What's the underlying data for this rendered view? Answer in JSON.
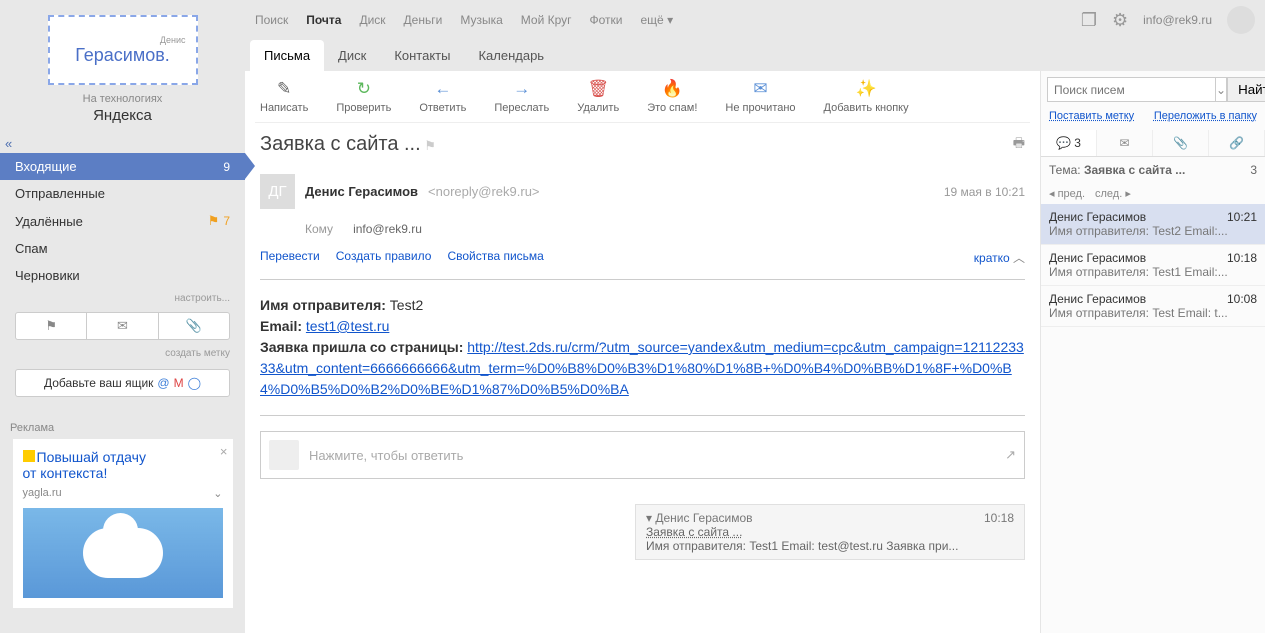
{
  "logo": {
    "name": "Герасимов.",
    "sub": "Денис"
  },
  "tech_label": "На технологиях",
  "yandex": "Яндекса",
  "folders": {
    "items": [
      {
        "label": "Входящие",
        "count": "9"
      },
      {
        "label": "Отправленные",
        "count": ""
      },
      {
        "label": "Удалённые",
        "count": "7"
      },
      {
        "label": "Спам",
        "count": ""
      },
      {
        "label": "Черновики",
        "count": ""
      }
    ],
    "setup": "настроить...",
    "create_label": "создать метку"
  },
  "add_box": "Добавьте ваш ящик",
  "ad": {
    "header": "Реклама",
    "title1": "Повышай отдачу",
    "title2": "от контекста!",
    "domain": "yagla.ru"
  },
  "topnav": {
    "items": [
      "Поиск",
      "Почта",
      "Диск",
      "Деньги",
      "Музыка",
      "Мой Круг",
      "Фотки",
      "ещё"
    ],
    "email": "info@rek9.ru"
  },
  "tabs": [
    "Письма",
    "Диск",
    "Контакты",
    "Календарь"
  ],
  "toolbar": [
    {
      "label": "Написать",
      "icon": "✎",
      "color": "#888"
    },
    {
      "label": "Проверить",
      "icon": "↻",
      "color": "#5cb85c"
    },
    {
      "label": "Ответить",
      "icon": "←",
      "color": "#5a8fd6"
    },
    {
      "label": "Переслать",
      "icon": "→",
      "color": "#5a8fd6"
    },
    {
      "label": "Удалить",
      "icon": "🗑",
      "color": "#d9534f"
    },
    {
      "label": "Это спам!",
      "icon": "🔥",
      "color": "#f0ad4e"
    },
    {
      "label": "Не прочитано",
      "icon": "✉",
      "color": "#5a8fd6"
    },
    {
      "label": "Добавить кнопку",
      "icon": "✨",
      "color": "#e07ab0"
    }
  ],
  "message": {
    "subject": "Заявка с сайта ...",
    "avatar": "ДГ",
    "sender_name": "Денис Герасимов",
    "sender_email": "<noreply@rek9.ru>",
    "date": "19 мая в 10:21",
    "to_label": "Кому",
    "to_value": "info@rek9.ru",
    "links": {
      "translate": "Перевести",
      "rule": "Создать правило",
      "props": "Свойства письма",
      "brief": "кратко"
    },
    "body": {
      "l1_label": "Имя отправителя:",
      "l1_val": " Test2",
      "l2_label": "Email:",
      "l2_link": "test1@test.ru",
      "l3_label": "Заявка пришла со страницы:",
      "l3_link": "http://test.2ds.ru/crm/?utm_source=yandex&utm_medium=cpc&utm_campaign=1211223333&utm_content=6666666666&utm_term=%D0%B8%D0%B3%D1%80%D1%8B+%D0%B4%D0%BB%D1%8F+%D0%B4%D0%B5%D0%B2%D0%BE%D1%87%D0%B5%D0%BA"
    },
    "reply_placeholder": "Нажмите, чтобы ответить"
  },
  "thread_preview": {
    "sender": "Денис Герасимов",
    "time": "10:18",
    "subject": "Заявка с сайта ...",
    "snippet": "Имя отправителя: Test1 Email: test@test.ru Заявка при..."
  },
  "right": {
    "search_ph": "Поиск писем",
    "search_btn": "Найти",
    "link1": "Поставить метку",
    "link2": "Переложить в папку",
    "tab_count": "3",
    "subject_label": "Тема:",
    "subject_val": "Заявка с сайта ...",
    "subject_count": "3",
    "prev": "пред.",
    "next": "след.",
    "messages": [
      {
        "sender": "Денис Герасимов",
        "time": "10:21",
        "preview": "Имя отправителя: Test2 Email:..."
      },
      {
        "sender": "Денис Герасимов",
        "time": "10:18",
        "preview": "Имя отправителя: Test1 Email:..."
      },
      {
        "sender": "Денис Герасимов",
        "time": "10:08",
        "preview": "Имя отправителя: Test Email: t..."
      }
    ]
  }
}
